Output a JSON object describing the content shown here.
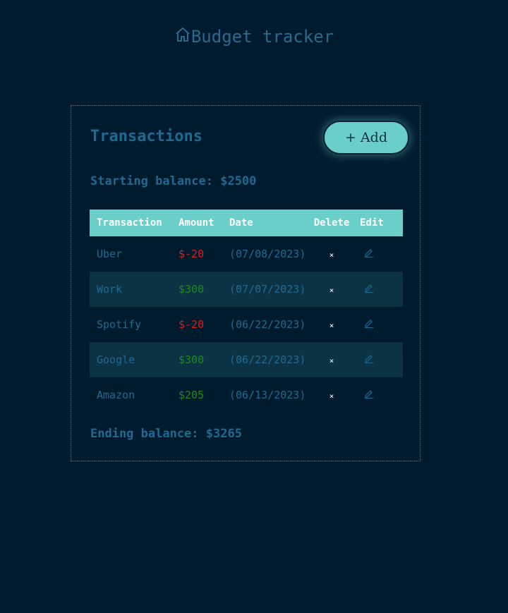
{
  "header": {
    "title": "Budget tracker",
    "icon": "home-icon"
  },
  "card": {
    "title": "Transactions",
    "add_label": "+ Add",
    "starting_balance": "Starting balance: $2500",
    "ending_balance": "Ending balance: $3265"
  },
  "table": {
    "headers": [
      "Transaction",
      "Amount",
      "Date",
      "Delete",
      "Edit"
    ],
    "rows": [
      {
        "name": "Uber",
        "amount": "$-20",
        "date": "(07/08/2023)",
        "delete": "×",
        "type": "neg"
      },
      {
        "name": "Work",
        "amount": "$300",
        "date": "(07/07/2023)",
        "delete": "×",
        "type": "pos"
      },
      {
        "name": "Spotify",
        "amount": "$-20",
        "date": "(06/22/2023)",
        "delete": "×",
        "type": "neg"
      },
      {
        "name": "Google",
        "amount": "$300",
        "date": "(06/22/2023)",
        "delete": "×",
        "type": "pos"
      },
      {
        "name": "Amazon",
        "amount": "$205",
        "date": "(06/13/2023)",
        "delete": "×",
        "type": "pos"
      }
    ]
  },
  "colors": {
    "background": "#011b2e",
    "accent": "#6acfc8",
    "text": "#1f6a91",
    "negative": "#e01b1b",
    "positive": "#1d8a1d"
  }
}
